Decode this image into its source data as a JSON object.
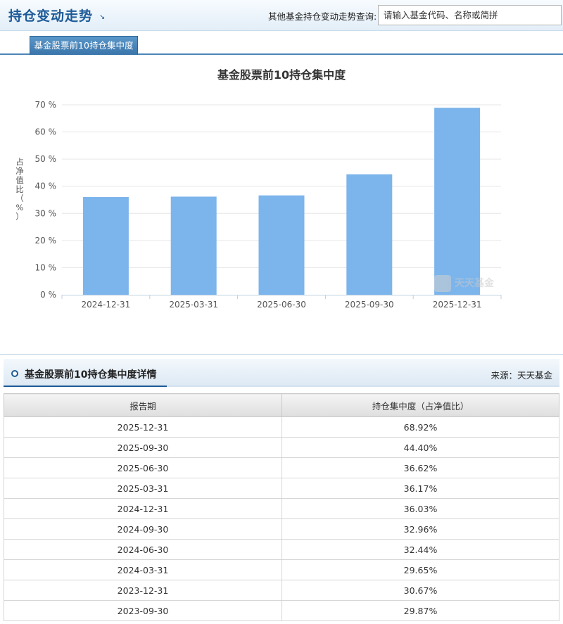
{
  "header": {
    "title": "持仓变动走势",
    "title_arrow": "↘",
    "query_label": "其他基金持仓变动走势查询:",
    "search_placeholder": "请输入基金代码、名称或简拼"
  },
  "tabs": [
    {
      "label": "基金股票前10持仓集中度",
      "active": true
    }
  ],
  "chart_data": {
    "type": "bar",
    "title": "基金股票前10持仓集中度",
    "ylabel": "占净值比（%）",
    "ylabel_chars": [
      "占",
      "净",
      "值",
      "比",
      "（",
      "%",
      "）"
    ],
    "categories": [
      "2024-12-31",
      "2025-03-31",
      "2025-06-30",
      "2025-09-30",
      "2025-12-31"
    ],
    "values": [
      36.03,
      36.17,
      36.62,
      44.4,
      68.92
    ],
    "ylim": [
      0,
      70
    ],
    "yticks": [
      0,
      10,
      20,
      30,
      40,
      50,
      60,
      70
    ],
    "ytick_labels": [
      "0 %",
      "10 %",
      "20 %",
      "30 %",
      "40 %",
      "50 %",
      "60 %",
      "70 %"
    ],
    "bar_color": "#7cb5ec",
    "grid": true,
    "watermark": "天天基金"
  },
  "detail": {
    "title": "基金股票前10持仓集中度详情",
    "source": "来源：天天基金",
    "columns": [
      "报告期",
      "持仓集中度（占净值比）"
    ],
    "rows": [
      [
        "2025-12-31",
        "68.92%"
      ],
      [
        "2025-09-30",
        "44.40%"
      ],
      [
        "2025-06-30",
        "36.62%"
      ],
      [
        "2025-03-31",
        "36.17%"
      ],
      [
        "2024-12-31",
        "36.03%"
      ],
      [
        "2024-09-30",
        "32.96%"
      ],
      [
        "2024-06-30",
        "32.44%"
      ],
      [
        "2024-03-31",
        "29.65%"
      ],
      [
        "2023-12-31",
        "30.67%"
      ],
      [
        "2023-09-30",
        "29.87%"
      ]
    ]
  },
  "colors": {
    "brand_blue": "#1d5a97",
    "tab_blue": "#3a75aa",
    "bar": "#7cb5ec"
  }
}
